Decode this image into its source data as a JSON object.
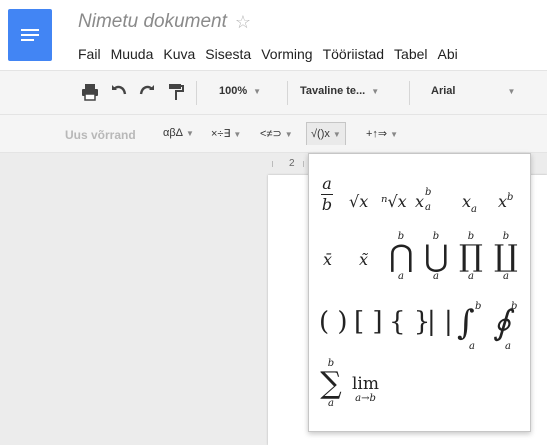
{
  "app": {
    "doc_title": "Nimetu dokument",
    "star_icon": "star-icon",
    "menu": [
      "Fail",
      "Muuda",
      "Kuva",
      "Sisesta",
      "Vorming",
      "Tööriistad",
      "Tabel",
      "Abi"
    ]
  },
  "toolbar": {
    "zoom": "100%",
    "style": "Tavaline te...",
    "font": "Arial"
  },
  "equation_toolbar": {
    "new_equation": "Uus võrrand",
    "greek": "αβΔ",
    "operators": "×÷∃",
    "relations": "<≠⊃",
    "math": "√()x",
    "arrows": "+↑⇒"
  },
  "ruler": {
    "marker": "2"
  },
  "math_panel": {
    "frac_num": "a",
    "frac_den": "b",
    "sqrt": "√x",
    "nth_root": "ⁿ√x",
    "sub_sup": "x",
    "sub_sup_sup": "b",
    "sub_sup_sub": "a",
    "subscript": "x",
    "subscript_sub": "a",
    "superscript": "x",
    "superscript_sup": "b",
    "bar": "x̄",
    "tilde": "x̃",
    "big_cap": "⋂",
    "big_cup": "⋃",
    "prod": "∏",
    "coprod": "∐",
    "upper_limit": "b",
    "lower_limit": "a",
    "parens": "( )",
    "brackets": "[ ]",
    "braces": "{ }",
    "abs": "| |",
    "integral": "∫",
    "contour_integral": "∮",
    "sum": "∑",
    "lim": "lim",
    "lim_sub": "a→b"
  }
}
